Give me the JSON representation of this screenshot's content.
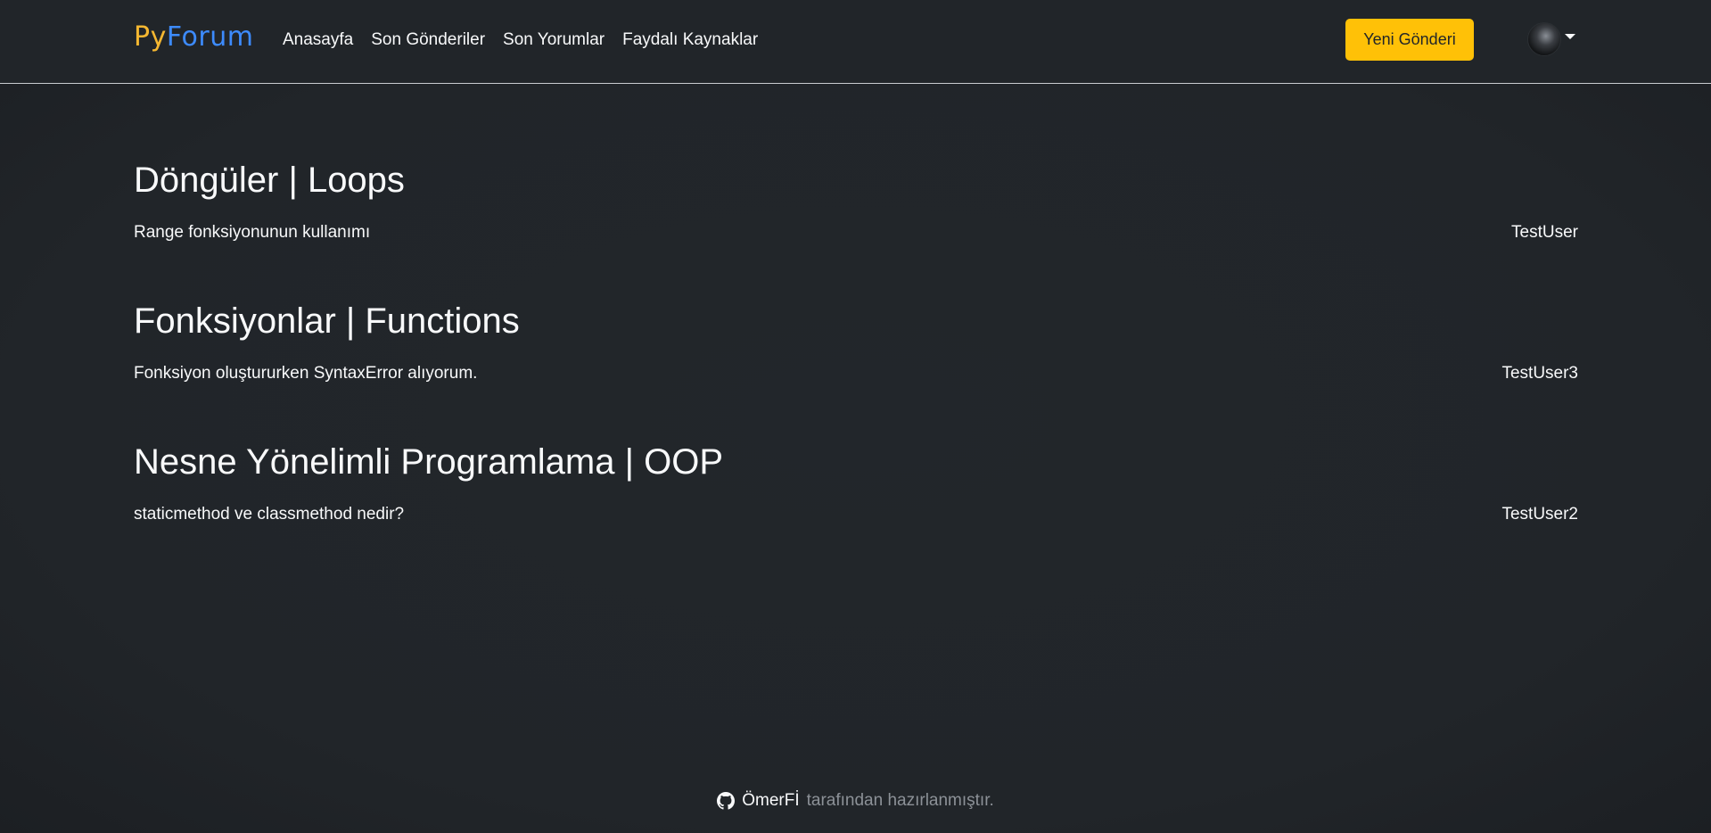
{
  "brand": {
    "part1": "Py",
    "part2": "Forum"
  },
  "nav": {
    "links": [
      "Anasayfa",
      "Son Gönderiler",
      "Son Yorumlar",
      "Faydalı Kaynaklar"
    ],
    "new_post_label": "Yeni Gönderi",
    "avatar_icon": "user-avatar",
    "caret_icon": "caret-down-icon"
  },
  "categories": [
    {
      "title": "Döngüler | Loops",
      "post_title": "Range fonksiyonunun kullanımı",
      "author": "TestUser"
    },
    {
      "title": "Fonksiyonlar | Functions",
      "post_title": "Fonksiyon oluştururken SyntaxError alıyorum.",
      "author": "TestUser3"
    },
    {
      "title": "Nesne Yönelimli Programlama | OOP",
      "post_title": "staticmethod ve classmethod nedir?",
      "author": "TestUser2"
    }
  ],
  "footer": {
    "icon": "github-icon",
    "author": "ÖmerFİ",
    "suffix": "tarafından hazırlanmıştır."
  },
  "colors": {
    "background": "#212529",
    "brand_py": "#f5b731",
    "brand_forum": "#3d8bfd",
    "button": "#ffc107",
    "muted": "#8c9197"
  }
}
